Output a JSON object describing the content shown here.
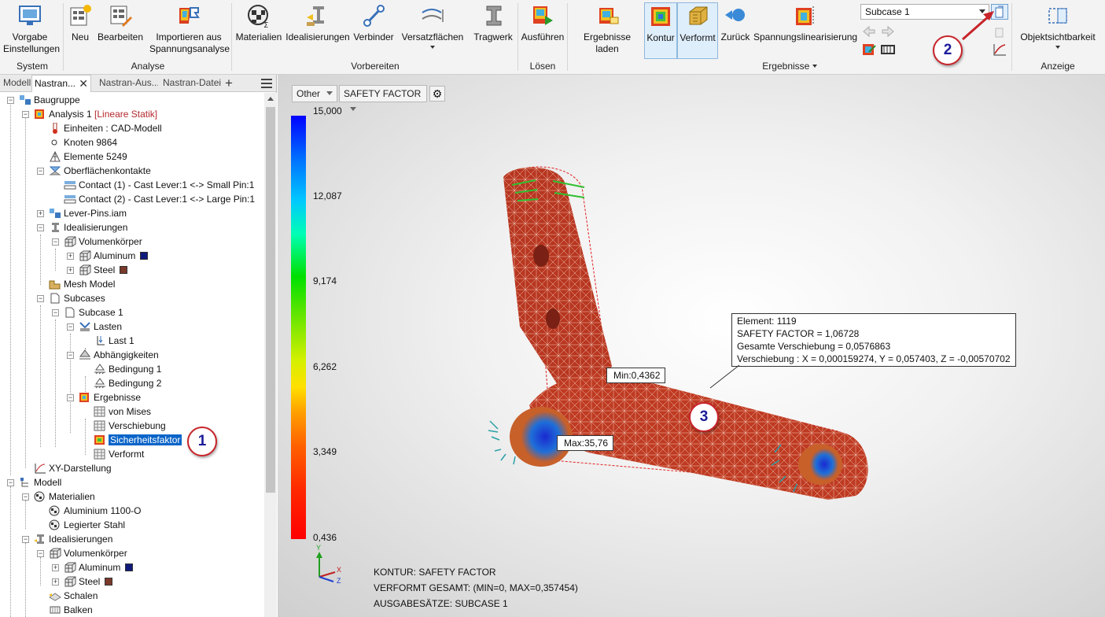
{
  "ribbon": {
    "system": {
      "vorgabe": "Vorgabe",
      "einstellungen": "Einstellungen",
      "label": "System"
    },
    "analyse": {
      "neu": "Neu",
      "bearbeiten": "Bearbeiten",
      "import1": "Importieren aus",
      "import2": "Spannungsanalyse",
      "label": "Analyse"
    },
    "vorbereiten": {
      "materialien": "Materialien",
      "idealisierungen": "Idealisierungen",
      "verbinder": "Verbinder",
      "versatz": "Versatzflächen",
      "tragwerk": "Tragwerk",
      "label": "Vorbereiten"
    },
    "loesen": {
      "ausfuehren": "Ausführen",
      "label": "Lösen"
    },
    "ergebnisse": {
      "laden": "Ergebnisse laden",
      "kontur": "Kontur",
      "verformt": "Verformt",
      "zurueck": "Zurück",
      "spannung": "Spannungslinearisierung",
      "label": "Ergebnisse"
    },
    "subcase": "Subcase 1",
    "anzeige": {
      "objekt": "Objektsichtbarkeit",
      "label": "Anzeige"
    }
  },
  "browser": {
    "tabs": [
      "Modell",
      "Nastran...",
      "Nastran-Aus...",
      "Nastran-Datei"
    ],
    "tree": {
      "baugruppe": "Baugruppe",
      "analysis": "Analysis 1",
      "analysis_type": "[Lineare Statik]",
      "einheiten": "Einheiten : CAD-Modell",
      "knoten": "Knoten 9864",
      "elemente": "Elemente 5249",
      "kontakte": "Oberflächenkontakte",
      "contact1": "Contact (1) - Cast Lever:1 <-> Small Pin:1",
      "contact2": "Contact (2) - Cast Lever:1 <-> Large Pin:1",
      "leverpins": "Lever-Pins.iam",
      "ideal": "Idealisierungen",
      "volumen": "Volumenkörper",
      "aluminum": "Aluminum",
      "steel": "Steel",
      "mesh": "Mesh Model",
      "subcases": "Subcases",
      "subcase1": "Subcase 1",
      "lasten": "Lasten",
      "last1": "Last 1",
      "abh": "Abhängigkeiten",
      "bed1": "Bedingung 1",
      "bed2": "Bedingung 2",
      "ergebnisse": "Ergebnisse",
      "vonmises": "von Mises",
      "verschiebung": "Verschiebung",
      "sicherheit": "Sicherheitsfaktor",
      "verformt": "Verformt",
      "xy": "XY-Darstellung",
      "modell": "Modell",
      "materialien": "Materialien",
      "alu1100": "Aluminium 1100-O",
      "legstahl": "Legierter Stahl",
      "ideal2": "Idealisierungen",
      "volumen2": "Volumenkörper",
      "aluminum2": "Aluminum",
      "steel2": "Steel",
      "schalen": "Schalen",
      "balken": "Balken"
    }
  },
  "viewport": {
    "drop1": "Other",
    "drop2": "SAFETY FACTOR",
    "legend": [
      "15,000",
      "12,087",
      "9,174",
      "6,262",
      "3,349",
      "0,436"
    ],
    "info": {
      "l1": "Element: 1119",
      "l2": "SAFETY FACTOR  = 1,06728",
      "l3": "Gesamte Verschiebung = 0,0576863",
      "l4": "Verschiebung : X = 0,000159274, Y = 0,057403, Z = -0,00570702"
    },
    "min": "Min:0,4362",
    "max": "Max:35,76",
    "status": [
      "KONTUR: SAFETY FACTOR",
      "VERFORMT GESAMT: (MIN=0, MAX=0,357454)",
      "AUSGABESÄTZE: SUBCASE 1"
    ],
    "axes": {
      "y": "Y",
      "x": "X",
      "z": "Z"
    }
  },
  "badges": [
    "1",
    "2",
    "3"
  ],
  "colors": {
    "highlight": "#0a64c8",
    "badge_border": "#c8242a",
    "badge_text": "#1b1b9a",
    "model": "#c0392b"
  }
}
